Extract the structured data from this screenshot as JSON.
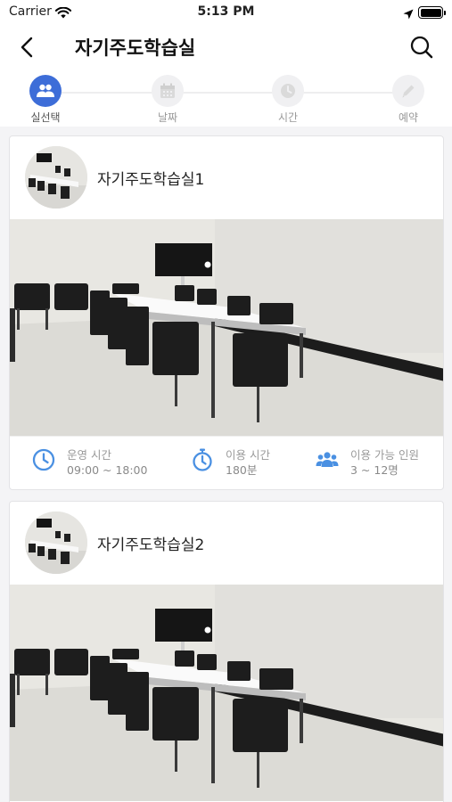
{
  "status_bar": {
    "carrier": "Carrier",
    "time": "5:13 PM"
  },
  "header": {
    "title": "자기주도학습실",
    "back_icon": "chevron-left-icon",
    "search_icon": "search-icon"
  },
  "stepper": {
    "active_color": "#3d6dd8",
    "steps": [
      {
        "label": "실선택",
        "icon": "people-icon",
        "active": true
      },
      {
        "label": "날짜",
        "icon": "calendar-icon",
        "active": false
      },
      {
        "label": "시간",
        "icon": "clock-icon",
        "active": false
      },
      {
        "label": "예약",
        "icon": "pencil-icon",
        "active": false
      }
    ]
  },
  "rooms": [
    {
      "name": "자기주도학습실1",
      "hours_label": "운영 시간",
      "hours_value": "09:00 ~ 18:00",
      "duration_label": "이용 시간",
      "duration_value": "180분",
      "capacity_label": "이용 가능 인원",
      "capacity_value": "3 ~ 12명"
    },
    {
      "name": "자기주도학습실2"
    }
  ],
  "icon_color": "#4a90e2"
}
